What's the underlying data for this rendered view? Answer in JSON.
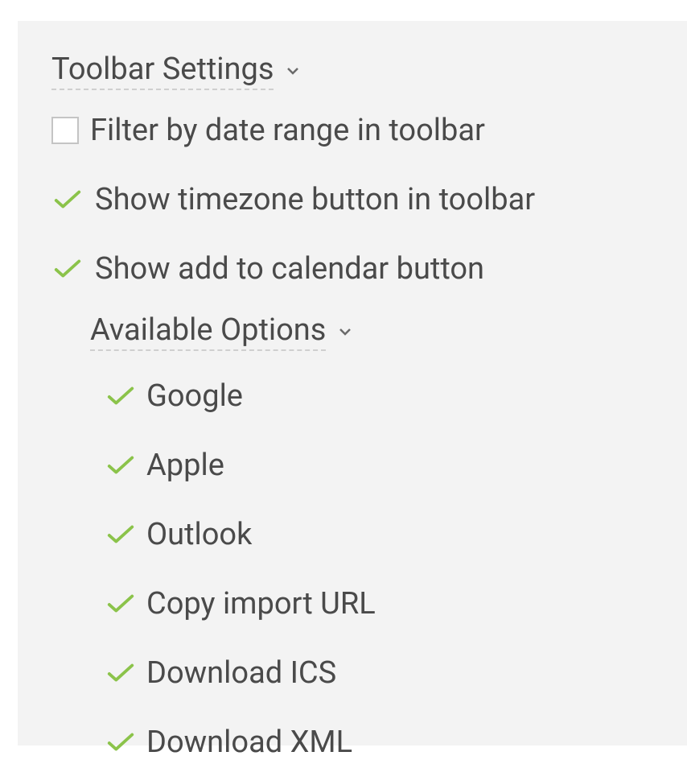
{
  "section": {
    "title": "Toolbar Settings",
    "options": [
      {
        "label": "Filter by date range in toolbar",
        "checked": false
      },
      {
        "label": "Show timezone button in toolbar",
        "checked": true
      },
      {
        "label": "Show add to calendar button",
        "checked": true
      }
    ],
    "subsection": {
      "title": "Available Options",
      "options": [
        {
          "label": "Google",
          "checked": true
        },
        {
          "label": "Apple",
          "checked": true
        },
        {
          "label": "Outlook",
          "checked": true
        },
        {
          "label": "Copy import URL",
          "checked": true
        },
        {
          "label": "Download ICS",
          "checked": true
        },
        {
          "label": "Download XML",
          "checked": true
        }
      ]
    }
  }
}
